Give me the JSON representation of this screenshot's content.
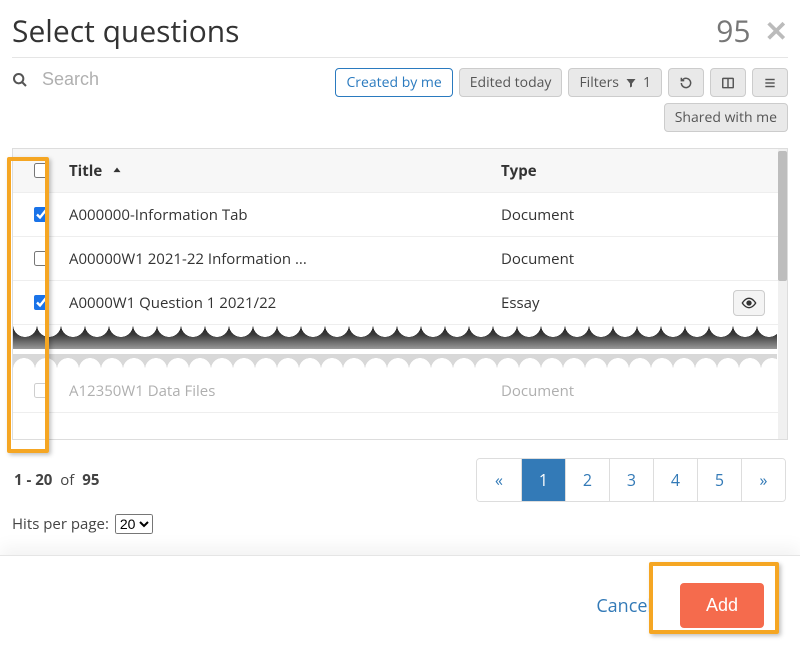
{
  "header": {
    "title": "Select questions",
    "count": "95"
  },
  "search": {
    "placeholder": "Search"
  },
  "filters": {
    "created_by_me": "Created by me",
    "edited_today": "Edited today",
    "filters_label": "Filters",
    "filters_count": "1",
    "shared_with_me": "Shared with me"
  },
  "table": {
    "headers": {
      "title": "Title",
      "type": "Type"
    },
    "rows": [
      {
        "checked": true,
        "title": "A000000-Information Tab",
        "type": "Document",
        "eye": false
      },
      {
        "checked": false,
        "title": "A00000W1 2021-22 Information ...",
        "type": "Document",
        "eye": false
      },
      {
        "checked": true,
        "title": "A0000W1 Question 1 2021/22",
        "type": "Essay",
        "eye": true
      }
    ],
    "faded_row": {
      "title": "A12350W1 Data Files",
      "type": "Document"
    }
  },
  "pagination": {
    "range_a": "1 - 20",
    "of_word": "of",
    "range_b": "95",
    "pages": [
      "1",
      "2",
      "3",
      "4",
      "5"
    ],
    "hits_label": "Hits per page:",
    "hits_value": "20"
  },
  "actions": {
    "cancel": "Cancel",
    "add": "Add"
  }
}
